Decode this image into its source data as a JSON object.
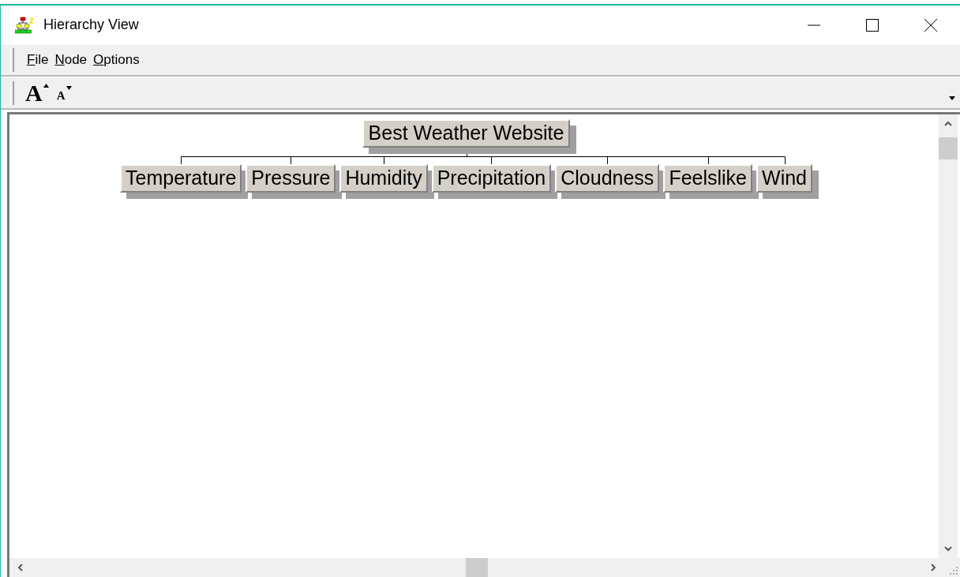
{
  "window": {
    "title": "Hierarchy View"
  },
  "menu": [
    {
      "label": "File",
      "underline_first": true
    },
    {
      "label": "Node",
      "underline_first": true
    },
    {
      "label": "Options",
      "underline_first": true
    }
  ],
  "toolbar": [
    {
      "label": "A",
      "kind": "grow"
    },
    {
      "label": "A",
      "kind": "shrink"
    }
  ],
  "tree": {
    "label": "Best Weather Website",
    "children": [
      {
        "label": "Temperature"
      },
      {
        "label": "Pressure"
      },
      {
        "label": "Humidity"
      },
      {
        "label": "Precipitation"
      },
      {
        "label": "Cloudness"
      },
      {
        "label": "Feelslike"
      },
      {
        "label": "Wind"
      }
    ]
  }
}
